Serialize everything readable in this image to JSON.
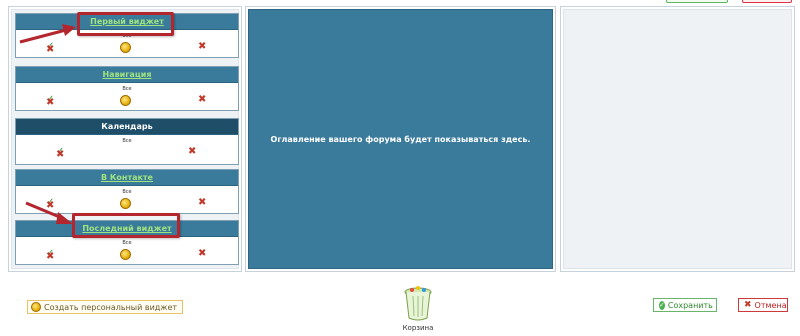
{
  "columns": {
    "middle_text": "Оглавление вашего форума будет показываться здесь."
  },
  "widgets": [
    {
      "title": "Первый виджет",
      "sub": "Все"
    },
    {
      "title": "Навигация",
      "sub": "Все"
    },
    {
      "title": "Календарь",
      "sub": "Все"
    },
    {
      "title": "В Контакте",
      "sub": "Все"
    },
    {
      "title": "Последний виджет",
      "sub": "Все"
    }
  ],
  "icons": {
    "edit": "edit-icon",
    "coin": "coin-icon",
    "delete": "delete-icon"
  },
  "footer": {
    "create_widget": "Создать персональный виджет",
    "trash_label": "Корзина",
    "save": "Сохранить",
    "cancel": "Отмена"
  },
  "colors": {
    "header_blue": "#3a7b9c",
    "link_green": "#9fe37e",
    "highlight_red": "#b3262e"
  }
}
